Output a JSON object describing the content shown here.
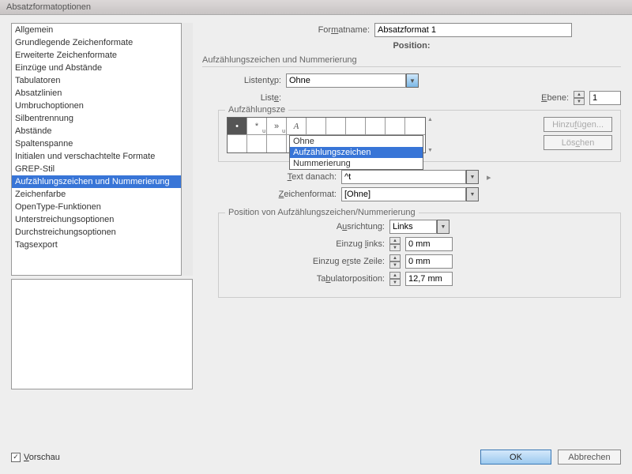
{
  "titlebar": "Absatzformatoptionen",
  "header": {
    "format_label_html": "For<span class='u'>m</span>atname:",
    "format_name": "Absatzformat 1",
    "position_label": "Position:",
    "section_title": "Aufzählungszeichen und Nummerierung"
  },
  "sidebar": {
    "items": [
      "Allgemein",
      "Grundlegende Zeichenformate",
      "Erweiterte Zeichenformate",
      "Einzüge und Abstände",
      "Tabulatoren",
      "Absatzlinien",
      "Umbruchoptionen",
      "Silbentrennung",
      "Abstände",
      "Spaltenspanne",
      "Initialen und verschachtelte Formate",
      "GREP-Stil",
      "Aufzählungszeichen und Nummerierung",
      "Zeichenfarbe",
      "OpenType-Funktionen",
      "Unterstreichungsoptionen",
      "Durchstreichungsoptionen",
      "Tagsexport"
    ],
    "selected_index": 12
  },
  "listentyp": {
    "label_html": "Listent<span class='u'>y</span>p:",
    "value": "Ohne",
    "options": [
      "Ohne",
      "Aufzählungszeichen",
      "Nummerierung"
    ],
    "highlight_index": 1
  },
  "liste": {
    "label_html": "List<span class='u'>e</span>:"
  },
  "ebene": {
    "label_html": "<span class='u'>E</span>bene:",
    "value": "1"
  },
  "glyph": {
    "legend_html": "Aufzählungsze",
    "row1": [
      "•",
      "*",
      "»",
      "A"
    ],
    "btn_add_html": "Hinzu<span class='u'>f</span>ügen...",
    "btn_del_html": "Lös<span class='u'>c</span>hen"
  },
  "text_after": {
    "label_html": "<span class='u'>T</span>ext danach:",
    "value": "^t"
  },
  "charfmt": {
    "label_html": "<span class='u'>Z</span>eichenformat:",
    "value": "[Ohne]"
  },
  "posgroup": {
    "legend": "Position von Aufzählungszeichen/Nummerierung",
    "align_label_html": "A<span class='u'>u</span>srichtung:",
    "align_value": "Links",
    "indent_left_label_html": "Einzug <span class='u'>l</span>inks:",
    "indent_left_value": "0 mm",
    "first_line_label_html": "Einzug e<span class='u'>r</span>ste Zeile:",
    "first_line_value": "0 mm",
    "tabpos_label_html": "Ta<span class='u'>b</span>ulatorposition:",
    "tabpos_value": "12,7 mm"
  },
  "footer": {
    "preview_html": "<span class='u'>V</span>orschau",
    "ok": "OK",
    "cancel": "Abbrechen"
  }
}
